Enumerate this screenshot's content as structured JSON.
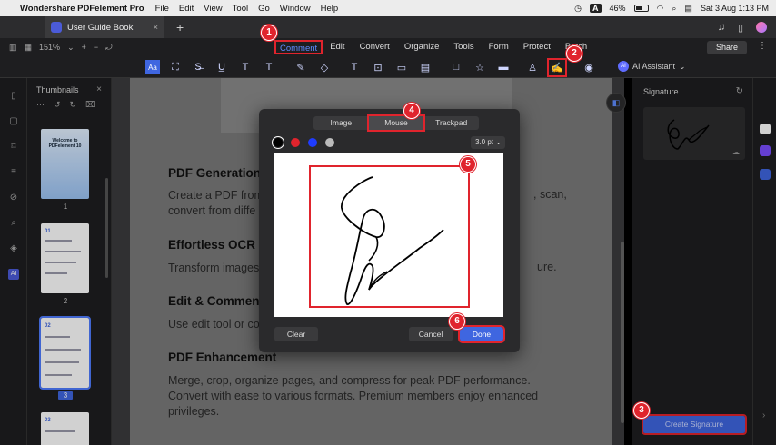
{
  "menubar": {
    "app_name": "Wondershare PDFelement Pro",
    "items": [
      "File",
      "Edit",
      "View",
      "Tool",
      "Go",
      "Window",
      "Help"
    ],
    "status_a": "A",
    "battery": "46%",
    "datetime": "Sat 3 Aug  1:13 PM"
  },
  "document": {
    "tab_title": "User Guide Book"
  },
  "zoom": {
    "level": "151%"
  },
  "menu_tabs": [
    "Comment",
    "Edit",
    "Convert",
    "Organize",
    "Tools",
    "Form",
    "Protect",
    "Batch"
  ],
  "share_label": "Share",
  "ai_assistant_label": "AI Assistant",
  "thumbnails": {
    "title": "Thumbnails",
    "pages": [
      "1",
      "2",
      "3"
    ],
    "thumb1_title": "Welcome to PDFelement 10",
    "thumb2_title": "01",
    "thumb3_title": "02",
    "thumb4_title": "03",
    "selected_page": "3"
  },
  "page_content": {
    "h1": "PDF Generation",
    "p1a": "Create a PDF from",
    "p1b": "convert from diffe",
    "p1_right": ", scan,",
    "h2": "Effortless OCR",
    "p2": "Transform images",
    "p2_right": "ure.",
    "h3": "Edit & Comment",
    "p3": "Use edit tool or co",
    "h4": "PDF Enhancement",
    "p4_line1": "Merge, crop, organize pages, and compress for peak PDF performance.",
    "p4_line2": "Convert with ease to various formats. Premium members enjoy enhanced",
    "p4_line3": "privileges."
  },
  "signature_panel": {
    "title": "Signature",
    "create_button": "Create Signature"
  },
  "dialog": {
    "tabs": [
      "Image",
      "Mouse",
      "Trackpad"
    ],
    "active_tab": "Mouse",
    "colors": [
      "#000000",
      "#e0242d",
      "#1f3cff",
      "#bbbbbb"
    ],
    "thickness": "3.0 pt",
    "clear_label": "Clear",
    "cancel_label": "Cancel",
    "done_label": "Done"
  },
  "steps": [
    "1",
    "2",
    "3",
    "4",
    "5",
    "6"
  ]
}
